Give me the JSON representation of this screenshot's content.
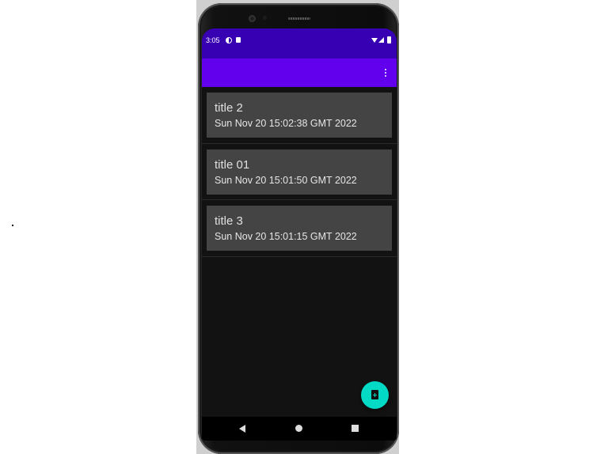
{
  "status_bar": {
    "time": "3:05",
    "icons": [
      "notification-icon",
      "sd-card-icon",
      "wifi-icon",
      "signal-icon",
      "battery-icon"
    ]
  },
  "app_bar": {
    "title": "",
    "menu_icon": "more-vert-icon"
  },
  "notes": [
    {
      "title": "title 2",
      "date": "Sun Nov 20 15:02:38 GMT 2022"
    },
    {
      "title": "title 01",
      "date": "Sun Nov 20 15:01:50 GMT 2022"
    },
    {
      "title": "title 3",
      "date": "Sun Nov 20 15:01:15 GMT 2022"
    }
  ],
  "fab": {
    "icon": "note-add-icon"
  },
  "nav_bar": {
    "icons": [
      "back-icon",
      "home-icon",
      "recents-icon"
    ]
  },
  "colors": {
    "status_bar": "#3700b3",
    "app_bar": "#6200ee",
    "background": "#121212",
    "card": "#444444",
    "fab": "#03dac5"
  }
}
